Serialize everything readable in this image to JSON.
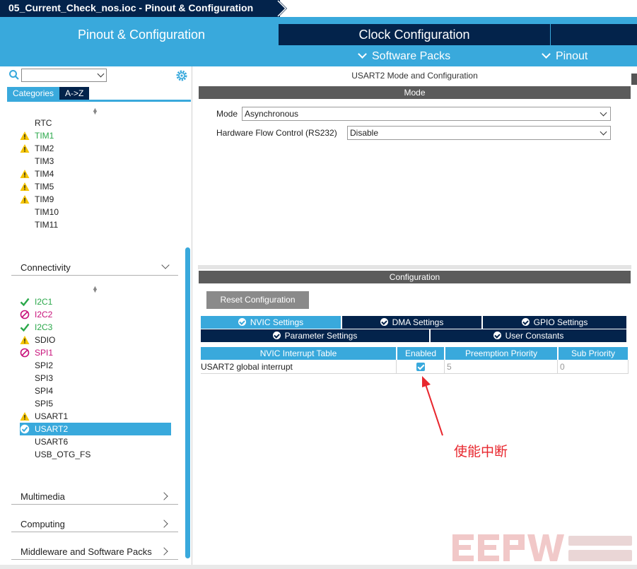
{
  "window": {
    "title": "05_Current_Check_nos.ioc - Pinout & Configuration"
  },
  "tabs": {
    "pinout": "Pinout & Configuration",
    "clock": "Clock Configuration",
    "software_packs": "Software Packs",
    "pinout_menu": "Pinout"
  },
  "left_panel": {
    "search": {
      "value": ""
    },
    "view_tabs": {
      "categories": "Categories",
      "az": "A->Z"
    },
    "timers": [
      {
        "name": "RTC",
        "status": "none"
      },
      {
        "name": "TIM1",
        "status": "warning"
      },
      {
        "name": "TIM2",
        "status": "warning"
      },
      {
        "name": "TIM3",
        "status": "none"
      },
      {
        "name": "TIM4",
        "status": "warning"
      },
      {
        "name": "TIM5",
        "status": "warning"
      },
      {
        "name": "TIM9",
        "status": "warning"
      },
      {
        "name": "TIM10",
        "status": "none"
      },
      {
        "name": "TIM11",
        "status": "none"
      }
    ],
    "sections": {
      "connectivity": "Connectivity",
      "multimedia": "Multimedia",
      "computing": "Computing",
      "middleware": "Middleware and Software Packs"
    },
    "connectivity": [
      {
        "name": "I2C1",
        "status": "ok"
      },
      {
        "name": "I2C2",
        "status": "disabled"
      },
      {
        "name": "I2C3",
        "status": "ok"
      },
      {
        "name": "SDIO",
        "status": "warning"
      },
      {
        "name": "SPI1",
        "status": "disabled"
      },
      {
        "name": "SPI2",
        "status": "none"
      },
      {
        "name": "SPI3",
        "status": "none"
      },
      {
        "name": "SPI4",
        "status": "none"
      },
      {
        "name": "SPI5",
        "status": "none"
      },
      {
        "name": "USART1",
        "status": "warning"
      },
      {
        "name": "USART2",
        "status": "selected"
      },
      {
        "name": "USART6",
        "status": "none"
      },
      {
        "name": "USB_OTG_FS",
        "status": "none"
      }
    ]
  },
  "right_panel": {
    "title": "USART2 Mode and Configuration",
    "mode_header": "Mode",
    "mode_label": "Mode",
    "mode_value": "Asynchronous",
    "flow_label": "Hardware Flow Control (RS232)",
    "flow_value": "Disable",
    "config_header": "Configuration",
    "reset_button": "Reset Configuration",
    "settings_tabs": {
      "nvic": "NVIC Settings",
      "dma": "DMA Settings",
      "gpio": "GPIO Settings",
      "parameter": "Parameter Settings",
      "user_constants": "User Constants"
    },
    "nvic_table": {
      "headers": [
        "NVIC Interrupt Table",
        "Enabled",
        "Preemption Priority",
        "Sub Priority"
      ],
      "rows": [
        {
          "name": "USART2 global interrupt",
          "enabled": true,
          "preemption": "5",
          "sub": "0"
        }
      ]
    },
    "annotation": "使能中断"
  },
  "colors": {
    "accent_blue": "#39a9dc",
    "navy": "#03234b",
    "annotation_red": "#e8272e",
    "ok_green": "#2aa84a",
    "warning_yellow": "#f5c400",
    "disabled_magenta": "#c8107a"
  }
}
